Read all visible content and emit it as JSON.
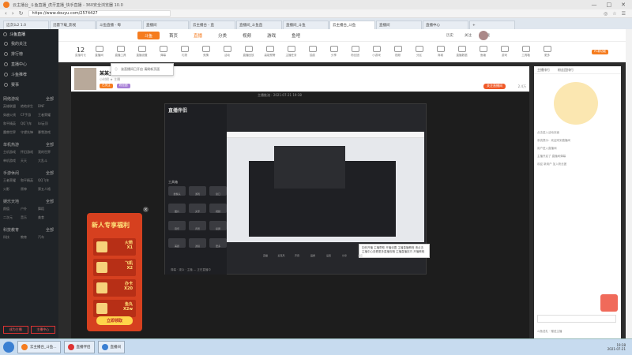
{
  "window": {
    "title": "云主播台_斗鱼直播_虎牙直播_快手直播 - 360安全浏览器 10.0",
    "controls": [
      "—",
      "□",
      "✕"
    ]
  },
  "address": {
    "url": "https://www.douyu.com/2574427",
    "right_items": [
      "◎",
      "☆",
      "☰"
    ]
  },
  "tabs": [
    {
      "label": "这次么2 1.0",
      "active": false
    },
    {
      "label": "迅雷下载_影视",
      "active": false
    },
    {
      "label": "斗鱼直播 - 每",
      "active": false
    },
    {
      "label": "直播间",
      "active": false
    },
    {
      "label": "云主播台 - 直",
      "active": false
    },
    {
      "label": "直播间_斗鱼直",
      "active": false
    },
    {
      "label": "直播间_斗鱼",
      "active": false
    },
    {
      "label": "云主播台_斗鱼",
      "active": true
    },
    {
      "label": "直播间",
      "active": false
    },
    {
      "label": "直播中心",
      "active": false
    },
    {
      "label": "+",
      "active": false
    }
  ],
  "sidebar": {
    "top_label": "斗鱼直播",
    "items": [
      "我的关注",
      "排行榜",
      "直播中心",
      "斗鱼推荐",
      "赛事"
    ],
    "sections": [
      {
        "title": "网络游戏",
        "more": "全部",
        "grid": [
          "英雄联盟",
          "绝地求生",
          "DNF",
          "穿越火线",
          "CF手游",
          "王者荣耀",
          "和平精英",
          "QQ飞车",
          "lol云顶",
          "魔兽世界",
          "守望先锋",
          "暴雪游戏"
        ]
      },
      {
        "title": "单机热游",
        "more": "全部",
        "grid": [
          "主机游戏",
          "怀旧游戏",
          "我的世界",
          "单机游戏",
          "天天",
          "大乱斗"
        ]
      },
      {
        "title": "手游休闲",
        "more": "全部",
        "grid": [
          "王者荣耀",
          "和平精英",
          "QQ飞车",
          "火影",
          "原神",
          "第五人格"
        ]
      },
      {
        "title": "娱乐天地",
        "more": "全部",
        "grid": [
          "颜值",
          "户外",
          "舞蹈",
          "二次元",
          "音乐",
          "美食"
        ]
      },
      {
        "title": "科技教育",
        "more": "全部",
        "grid": [
          "科技",
          "教育",
          "汽车"
        ]
      }
    ],
    "bottom_buttons": [
      "成为主播",
      "主播中心"
    ]
  },
  "topnav": {
    "brand": "斗鱼",
    "items": [
      "首页",
      "直播",
      "分类",
      "视频",
      "游戏",
      "鱼吧"
    ],
    "active": "直播",
    "right": [
      "历史",
      "关注",
      "下载"
    ]
  },
  "categories": {
    "count": "12",
    "count_label": "直播时长",
    "items": [
      "直播间",
      "直播工具",
      "直播设置",
      "弹幕",
      "礼物",
      "竞猜",
      "活动",
      "直播回放",
      "高能预警",
      "主播任务",
      "抽奖",
      "分享",
      "粉丝团",
      "小游戏",
      "视频",
      "分区",
      "商城",
      "直播数据",
      "鱼塘",
      "游戏",
      "工具箱",
      "更多"
    ],
    "pc_badge": "PC新功能"
  },
  "popup": {
    "text": "该直播间已开启 请刷新页面"
  },
  "room": {
    "name": "某某主",
    "tag": "小时榜 ★ 主播",
    "btn1": "已关注",
    "btn2": "粉丝团",
    "subscribe": "关注直播间",
    "fans": "2.4万"
  },
  "player": {
    "title": "主播推流 · 2021-07-21 19:38"
  },
  "inner_app": {
    "brand": "直播伴侣",
    "section_label": "工具箱",
    "tools": [
      "摄像头",
      "游戏",
      "窗口",
      "图片",
      "文字",
      "视频",
      "音乐",
      "背景",
      "投屏",
      "美颜",
      "滤镜",
      "更多"
    ],
    "status": "弹幕 · 观众 · 主播 — 正在直播中"
  },
  "tooltip": {
    "text": "如何开播 主播帮助 开播设置 主播直播教程 请点击 主播中心查看更多直播攻略 主播直播技巧 开播教程"
  },
  "toolrow": [
    "直播",
    "麦克风",
    "声音",
    "画质",
    "设置",
    "分享",
    "商店"
  ],
  "banner": {
    "title": "新人专享福利",
    "rows": [
      {
        "label": "火箭",
        "qty": "X1"
      },
      {
        "label": "飞机",
        "qty": "X2"
      },
      {
        "label": "办卡",
        "qty": "X20"
      },
      {
        "label": "鱼丸",
        "qty": "X2w"
      }
    ],
    "button": "立即领取",
    "close": "×"
  },
  "right_panel": {
    "tabs": [
      "主播排行",
      "粉丝团排行"
    ],
    "messages": [
      "点击进入活动页面",
      "系统提示：欢迎来到直播间",
      "用户进入直播间",
      "主播开启了 直播间弹幕",
      "欢迎 新用户 加入粉丝团"
    ],
    "bottom": "斗鱼送礼 · 赠送主播"
  },
  "taskbar": {
    "items": [
      {
        "label": "云主播台_斗鱼..."
      },
      {
        "label": "直播伴侣"
      },
      {
        "label": "直播间"
      }
    ],
    "time": "19:38",
    "date": "2021-07-21"
  },
  "colors": {
    "accent": "#f57c1f",
    "danger": "#d6401f",
    "banner_text": "#ffe27a"
  }
}
